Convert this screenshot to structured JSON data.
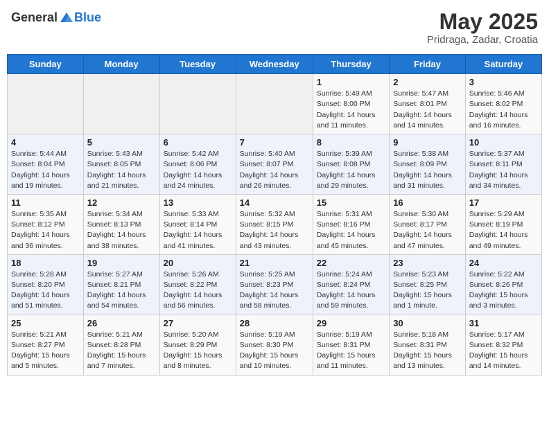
{
  "logo": {
    "general": "General",
    "blue": "Blue"
  },
  "title": "May 2025",
  "subtitle": "Pridraga, Zadar, Croatia",
  "days_of_week": [
    "Sunday",
    "Monday",
    "Tuesday",
    "Wednesday",
    "Thursday",
    "Friday",
    "Saturday"
  ],
  "weeks": [
    [
      {
        "day": "",
        "info": ""
      },
      {
        "day": "",
        "info": ""
      },
      {
        "day": "",
        "info": ""
      },
      {
        "day": "",
        "info": ""
      },
      {
        "day": "1",
        "info": "Sunrise: 5:49 AM\nSunset: 8:00 PM\nDaylight: 14 hours and 11 minutes."
      },
      {
        "day": "2",
        "info": "Sunrise: 5:47 AM\nSunset: 8:01 PM\nDaylight: 14 hours and 14 minutes."
      },
      {
        "day": "3",
        "info": "Sunrise: 5:46 AM\nSunset: 8:02 PM\nDaylight: 14 hours and 16 minutes."
      }
    ],
    [
      {
        "day": "4",
        "info": "Sunrise: 5:44 AM\nSunset: 8:04 PM\nDaylight: 14 hours and 19 minutes."
      },
      {
        "day": "5",
        "info": "Sunrise: 5:43 AM\nSunset: 8:05 PM\nDaylight: 14 hours and 21 minutes."
      },
      {
        "day": "6",
        "info": "Sunrise: 5:42 AM\nSunset: 8:06 PM\nDaylight: 14 hours and 24 minutes."
      },
      {
        "day": "7",
        "info": "Sunrise: 5:40 AM\nSunset: 8:07 PM\nDaylight: 14 hours and 26 minutes."
      },
      {
        "day": "8",
        "info": "Sunrise: 5:39 AM\nSunset: 8:08 PM\nDaylight: 14 hours and 29 minutes."
      },
      {
        "day": "9",
        "info": "Sunrise: 5:38 AM\nSunset: 8:09 PM\nDaylight: 14 hours and 31 minutes."
      },
      {
        "day": "10",
        "info": "Sunrise: 5:37 AM\nSunset: 8:11 PM\nDaylight: 14 hours and 34 minutes."
      }
    ],
    [
      {
        "day": "11",
        "info": "Sunrise: 5:35 AM\nSunset: 8:12 PM\nDaylight: 14 hours and 36 minutes."
      },
      {
        "day": "12",
        "info": "Sunrise: 5:34 AM\nSunset: 8:13 PM\nDaylight: 14 hours and 38 minutes."
      },
      {
        "day": "13",
        "info": "Sunrise: 5:33 AM\nSunset: 8:14 PM\nDaylight: 14 hours and 41 minutes."
      },
      {
        "day": "14",
        "info": "Sunrise: 5:32 AM\nSunset: 8:15 PM\nDaylight: 14 hours and 43 minutes."
      },
      {
        "day": "15",
        "info": "Sunrise: 5:31 AM\nSunset: 8:16 PM\nDaylight: 14 hours and 45 minutes."
      },
      {
        "day": "16",
        "info": "Sunrise: 5:30 AM\nSunset: 8:17 PM\nDaylight: 14 hours and 47 minutes."
      },
      {
        "day": "17",
        "info": "Sunrise: 5:29 AM\nSunset: 8:19 PM\nDaylight: 14 hours and 49 minutes."
      }
    ],
    [
      {
        "day": "18",
        "info": "Sunrise: 5:28 AM\nSunset: 8:20 PM\nDaylight: 14 hours and 51 minutes."
      },
      {
        "day": "19",
        "info": "Sunrise: 5:27 AM\nSunset: 8:21 PM\nDaylight: 14 hours and 54 minutes."
      },
      {
        "day": "20",
        "info": "Sunrise: 5:26 AM\nSunset: 8:22 PM\nDaylight: 14 hours and 56 minutes."
      },
      {
        "day": "21",
        "info": "Sunrise: 5:25 AM\nSunset: 8:23 PM\nDaylight: 14 hours and 58 minutes."
      },
      {
        "day": "22",
        "info": "Sunrise: 5:24 AM\nSunset: 8:24 PM\nDaylight: 14 hours and 59 minutes."
      },
      {
        "day": "23",
        "info": "Sunrise: 5:23 AM\nSunset: 8:25 PM\nDaylight: 15 hours and 1 minute."
      },
      {
        "day": "24",
        "info": "Sunrise: 5:22 AM\nSunset: 8:26 PM\nDaylight: 15 hours and 3 minutes."
      }
    ],
    [
      {
        "day": "25",
        "info": "Sunrise: 5:21 AM\nSunset: 8:27 PM\nDaylight: 15 hours and 5 minutes."
      },
      {
        "day": "26",
        "info": "Sunrise: 5:21 AM\nSunset: 8:28 PM\nDaylight: 15 hours and 7 minutes."
      },
      {
        "day": "27",
        "info": "Sunrise: 5:20 AM\nSunset: 8:29 PM\nDaylight: 15 hours and 8 minutes."
      },
      {
        "day": "28",
        "info": "Sunrise: 5:19 AM\nSunset: 8:30 PM\nDaylight: 15 hours and 10 minutes."
      },
      {
        "day": "29",
        "info": "Sunrise: 5:19 AM\nSunset: 8:31 PM\nDaylight: 15 hours and 11 minutes."
      },
      {
        "day": "30",
        "info": "Sunrise: 5:18 AM\nSunset: 8:31 PM\nDaylight: 15 hours and 13 minutes."
      },
      {
        "day": "31",
        "info": "Sunrise: 5:17 AM\nSunset: 8:32 PM\nDaylight: 15 hours and 14 minutes."
      }
    ]
  ]
}
